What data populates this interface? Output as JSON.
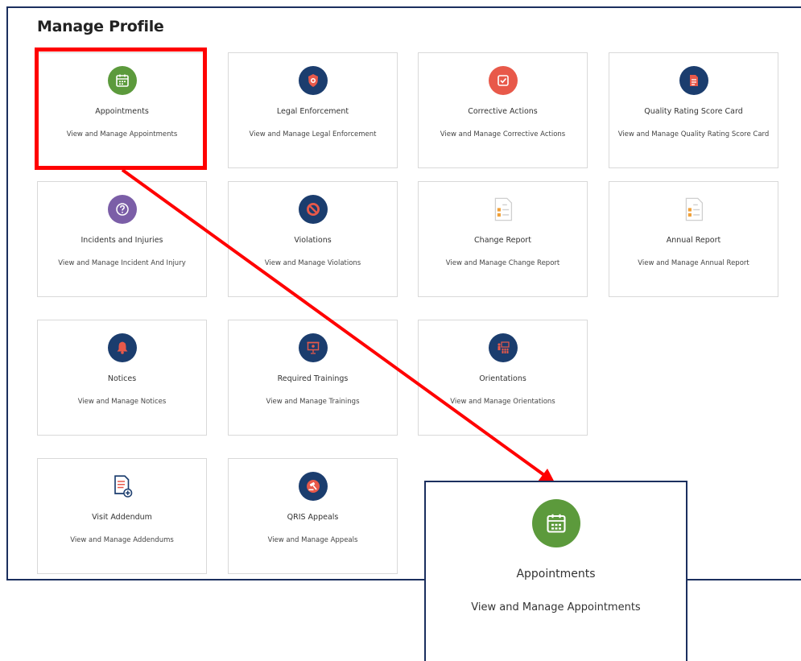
{
  "page": {
    "title": "Manage Profile"
  },
  "cards": [
    {
      "id": "appointments",
      "name": "Appointments",
      "desc": "View and Manage Appointments",
      "icon": "calendar-icon",
      "color": "#5c9a3c"
    },
    {
      "id": "legal-enforcement",
      "name": "Legal Enforcement",
      "desc": "View and Manage Legal Enforcement",
      "icon": "badge-icon",
      "color": "#1b3d6e"
    },
    {
      "id": "corrective-actions",
      "name": "Corrective Actions",
      "desc": "View and Manage Corrective Actions",
      "icon": "checkbox-icon",
      "color": "#e8594a"
    },
    {
      "id": "quality-rating",
      "name": "Quality Rating Score Card",
      "desc": "View and Manage Quality Rating Score Card",
      "icon": "scorecard-icon",
      "color": "#1b3d6e"
    },
    {
      "id": "incidents",
      "name": "Incidents and Injuries",
      "desc": "View and Manage Incident And Injury",
      "icon": "question-icon",
      "color": "#7b5ea7"
    },
    {
      "id": "violations",
      "name": "Violations",
      "desc": "View and Manage Violations",
      "icon": "prohibited-icon",
      "color": "#1b3d6e"
    },
    {
      "id": "change-report",
      "name": "Change Report",
      "desc": "View and Manage Change Report",
      "icon": "report-document-icon",
      "color": "#ffffff"
    },
    {
      "id": "annual-report",
      "name": "Annual Report",
      "desc": "View and Manage Annual Report",
      "icon": "report-document-icon",
      "color": "#ffffff"
    },
    {
      "id": "notices",
      "name": "Notices",
      "desc": "View and Manage Notices",
      "icon": "bell-icon",
      "color": "#1b3d6e"
    },
    {
      "id": "required-trainings",
      "name": "Required Trainings",
      "desc": "View and Manage Trainings",
      "icon": "presentation-icon",
      "color": "#1b3d6e"
    },
    {
      "id": "orientations",
      "name": "Orientations",
      "desc": "View and Manage Orientations",
      "icon": "group-presentation-icon",
      "color": "#1b3d6e"
    },
    {
      "id": "visit-addendum",
      "name": "Visit Addendum",
      "desc": "View and Manage Addendums",
      "icon": "document-add-icon",
      "color": "#ffffff"
    },
    {
      "id": "qris-appeals",
      "name": "QRIS Appeals",
      "desc": "View and Manage Appeals",
      "icon": "gavel-icon",
      "color": "#1b3d6e"
    }
  ],
  "zoom": {
    "name": "Appointments",
    "desc": "View and Manage Appointments",
    "icon": "calendar-icon",
    "color": "#5c9a3c"
  },
  "colors": {
    "highlight": "#ff0000",
    "frame": "#1b2f5e"
  }
}
